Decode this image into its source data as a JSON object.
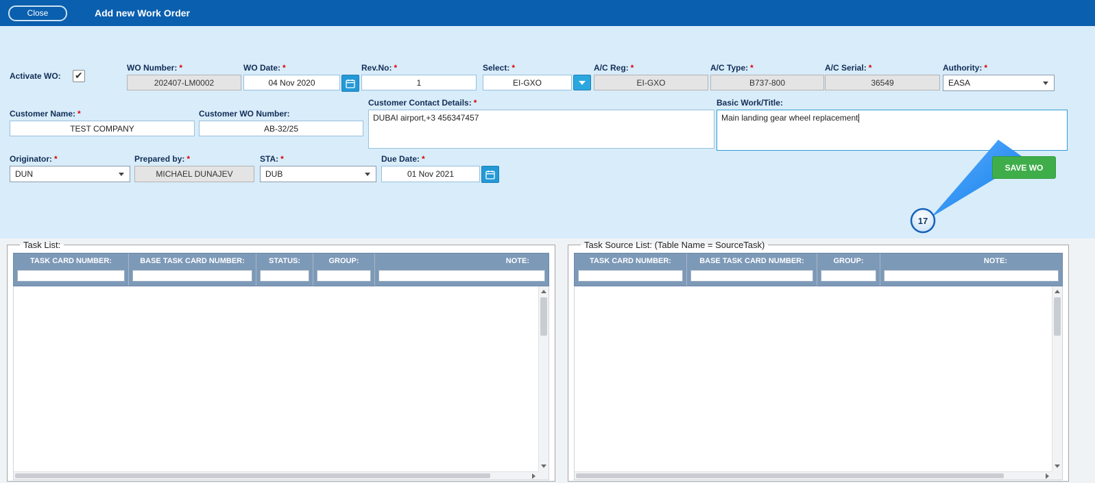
{
  "header": {
    "close_label": "Close",
    "title": "Add new Work Order"
  },
  "form": {
    "required_mark": "*",
    "activate_wo": {
      "label": "Activate WO:",
      "checked": true
    },
    "wo_number": {
      "label": "WO Number:",
      "value": "202407-LM0002"
    },
    "wo_date": {
      "label": "WO Date:",
      "value": "04 Nov 2020"
    },
    "rev_no": {
      "label": "Rev.No:",
      "value": "1"
    },
    "select": {
      "label": "Select:",
      "value": "EI-GXO"
    },
    "ac_reg": {
      "label": "A/C Reg:",
      "value": "EI-GXO"
    },
    "ac_type": {
      "label": "A/C Type:",
      "value": "B737-800"
    },
    "ac_serial": {
      "label": "A/C Serial:",
      "value": "36549"
    },
    "authority": {
      "label": "Authority:",
      "value": "EASA"
    },
    "customer_name": {
      "label": "Customer Name:",
      "value": "TEST COMPANY"
    },
    "customer_wo_number": {
      "label": "Customer WO Number:",
      "value": "AB-32/25"
    },
    "customer_contact": {
      "label": "Customer Contact Details:",
      "value": "DUBAI airport,+3 456347457"
    },
    "basic_work_title": {
      "label": "Basic Work/Title:",
      "value": "Main landing gear wheel replacement"
    },
    "originator": {
      "label": "Originator:",
      "value": "DUN"
    },
    "prepared_by": {
      "label": "Prepared by:",
      "value": "MICHAEL DUNAJEV"
    },
    "sta": {
      "label": "STA:",
      "value": "DUB"
    },
    "due_date": {
      "label": "Due Date:",
      "value": "01 Nov 2021"
    },
    "save_label": "SAVE WO"
  },
  "callout": {
    "step_number": "17"
  },
  "panels": {
    "task_list": {
      "legend": "Task List:",
      "columns": [
        "TASK CARD NUMBER:",
        "BASE TASK CARD NUMBER:",
        "STATUS:",
        "GROUP:",
        "NOTE:"
      ]
    },
    "task_source_list": {
      "legend": "Task Source List: (Table Name = SourceTask)",
      "columns": [
        "TASK CARD NUMBER:",
        "BASE TASK CARD NUMBER:",
        "GROUP:",
        "NOTE:"
      ]
    }
  },
  "colors": {
    "topbar_blue": "#0a5fae",
    "form_bg": "#d8ecfa",
    "panel_header": "#7d99b8",
    "save_green": "#3fae4a",
    "accent_blue": "#2499d6",
    "callout_blue": "#1e8ef7"
  }
}
